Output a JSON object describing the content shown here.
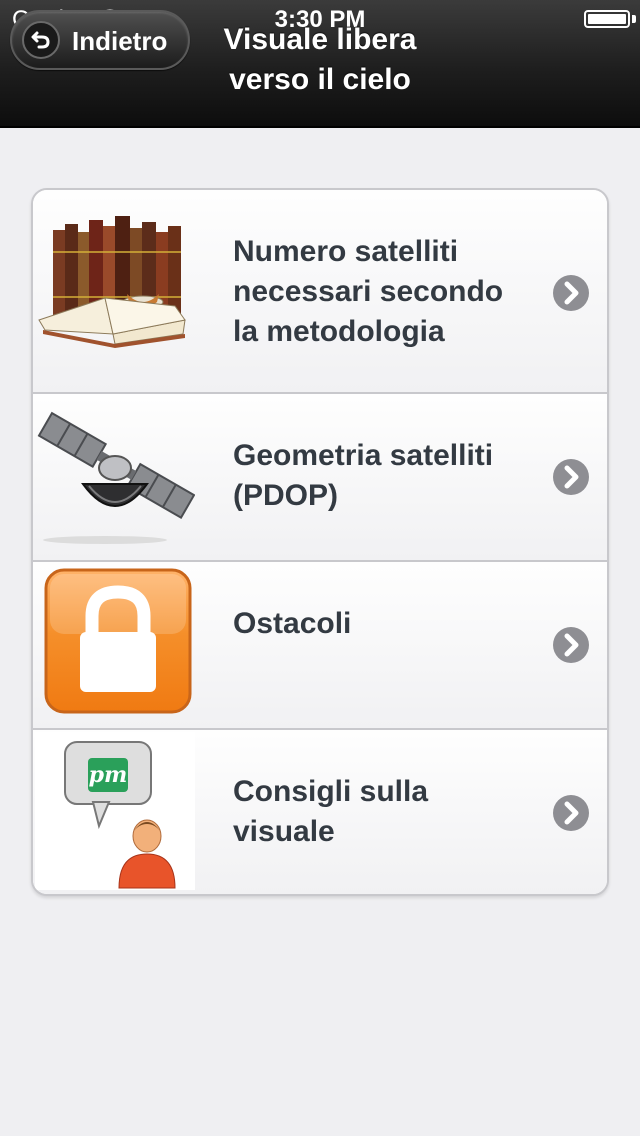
{
  "status_bar": {
    "carrier": "Carrier",
    "time": "3:30 PM"
  },
  "navbar": {
    "back_label": "Indietro",
    "title_line1": "Visuale libera",
    "title_line2": "verso il cielo"
  },
  "menu": {
    "items": [
      {
        "line1": "Numero satelliti",
        "line2": "necessari secondo",
        "line3": "la metodologia",
        "icon": "books-icon"
      },
      {
        "line1": "Geometria satelliti",
        "line2": "(PDOP)",
        "icon": "satellite-icon"
      },
      {
        "line1": "Ostacoli",
        "icon": "lock-icon"
      },
      {
        "line1": "Consigli sulla",
        "line2": "visuale",
        "icon": "user-chat-icon",
        "badge": "pm"
      }
    ]
  },
  "colors": {
    "navbar": "#1e1e1e",
    "background": "#efeff2",
    "label": "#333a42",
    "chevron": "#8e8e93",
    "lock_orange": "#f58f2a",
    "badge_green": "#2aa05a"
  }
}
